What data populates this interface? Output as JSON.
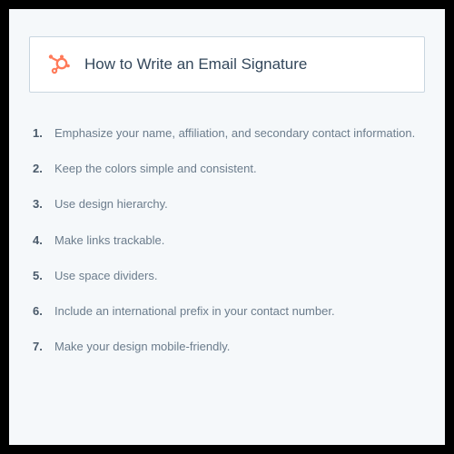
{
  "header": {
    "title": "How to Write an Email Signature",
    "logo_color": "#ff7a59"
  },
  "items": [
    {
      "num": "1.",
      "text": "Emphasize your name, affiliation, and secondary contact information."
    },
    {
      "num": "2.",
      "text": "Keep the colors simple and consistent."
    },
    {
      "num": "3.",
      "text": "Use design hierarchy."
    },
    {
      "num": "4.",
      "text": "Make links trackable."
    },
    {
      "num": "5.",
      "text": "Use space dividers."
    },
    {
      "num": "6.",
      "text": "Include an international prefix in your contact number."
    },
    {
      "num": "7.",
      "text": "Make your design mobile-friendly."
    }
  ]
}
